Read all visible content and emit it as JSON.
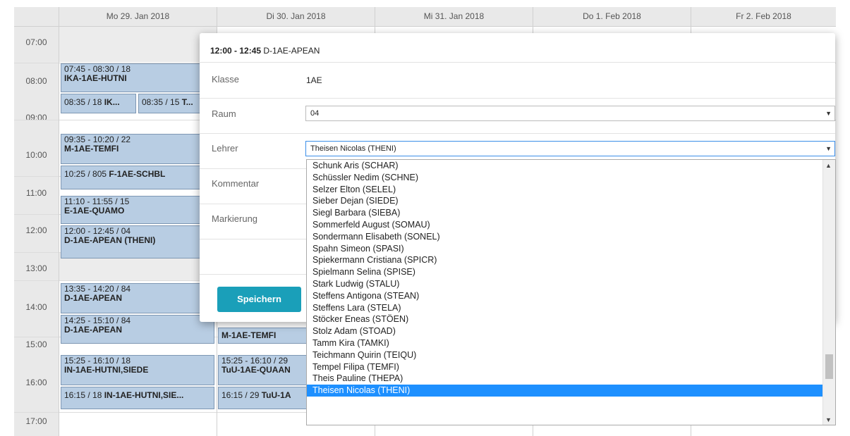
{
  "days": [
    "Mo 29. Jan 2018",
    "Di 30. Jan 2018",
    "Mi 31. Jan 2018",
    "Do 1. Feb 2018",
    "Fr 2. Feb 2018"
  ],
  "times": [
    "07:00",
    "08:00",
    "09:00",
    "10:00",
    "11:00",
    "12:00",
    "13:00",
    "14:00",
    "15:00",
    "16:00",
    "17:00"
  ],
  "events": {
    "e1_l1": "07:45 - 08:30 / 18",
    "e1_l2": "IKA-1AE-HUTNI",
    "e2a_pre": "08:35 / 18 ",
    "e2a_b": "IK...",
    "e2b_pre": "08:35 / 15 ",
    "e2b_b": "T...",
    "e3_l1": "09:35 - 10:20 / 22",
    "e3_l2": "M-1AE-TEMFI",
    "e4_pre": "10:25 / 805 ",
    "e4_b": "F-1AE-SCHBL",
    "e5_l1": "11:10 - 11:55 / 15",
    "e5_l2": "E-1AE-QUAMO",
    "e6_l1": "12:00 - 12:45 / 04",
    "e6_l2": "D-1AE-APEAN (THENI)",
    "e7_l1": "13:35 - 14:20 / 84",
    "e7_l2": "D-1AE-APEAN",
    "e8_l1": "14:25 - 15:10 / 84",
    "e8_l2": "D-1AE-APEAN",
    "e9_l1": "15:25 - 16:10 / 18",
    "e9_l2": "IN-1AE-HUTNI,SIEDE",
    "e10_pre": "16:15 / 18 ",
    "e10_b": "IN-1AE-HUTNI,SIE...",
    "t1_l2": "M-1AE-TEMFI",
    "t2_l1": "15:25 - 16:10 / 29",
    "t2_l2": "TuU-1AE-QUAAN",
    "t3_pre": "16:15 / 29 ",
    "t3_b": "TuU-1A"
  },
  "modal": {
    "title_time": "12:00 - 12:45",
    "title_name": " D-1AE-APEAN",
    "klasse_label": "Klasse",
    "klasse_value": "1AE",
    "raum_label": "Raum",
    "raum_value": "04",
    "lehrer_label": "Lehrer",
    "lehrer_value": "Theisen Nicolas (THENI)",
    "kommentar_label": "Kommentar",
    "markierung_label": "Markierung",
    "save_label": "Speichern"
  },
  "teacher_options": [
    "Schunk Aris (SCHAR)",
    "Schüssler Nedim (SCHNE)",
    "Selzer Elton (SELEL)",
    "Sieber Dejan (SIEDE)",
    "Siegl Barbara (SIEBA)",
    "Sommerfeld August (SOMAU)",
    "Sondermann Elisabeth (SONEL)",
    "Spahn Simeon (SPASI)",
    "Spiekermann Cristiana (SPICR)",
    "Spielmann Selina (SPISE)",
    "Stark Ludwig (STALU)",
    "Steffens Antigona (STEAN)",
    "Steffens Lara (STELA)",
    "Stöcker Eneas (STÖEN)",
    "Stolz Adam (STOAD)",
    "Tamm Kira (TAMKI)",
    "Teichmann Quirin (TEIQU)",
    "Tempel Filipa (TEMFI)",
    "Theis Pauline (THEPA)",
    "Theisen Nicolas (THENI)"
  ],
  "selected_option": "Theisen Nicolas (THENI)",
  "colors": {
    "event_bg": "#b8cde3",
    "button_bg": "#1a9fb9",
    "selected_bg": "#1e90ff"
  }
}
